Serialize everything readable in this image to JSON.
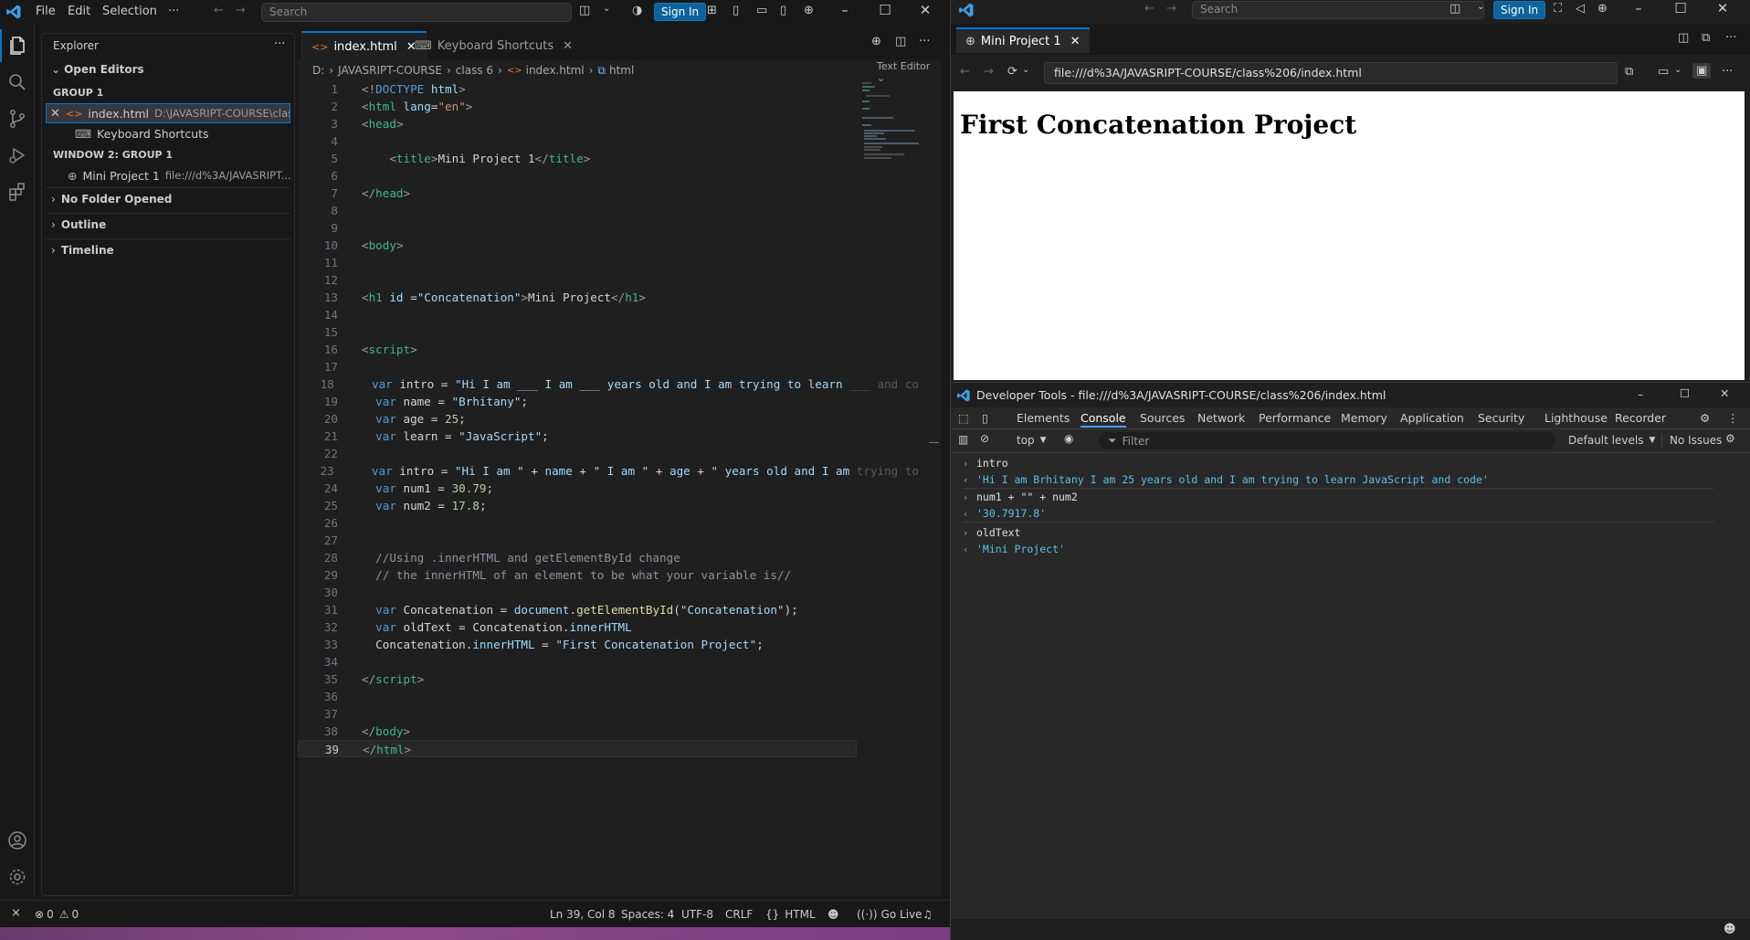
{
  "left_window": {
    "menu": [
      "File",
      "Edit",
      "Selection",
      "···"
    ],
    "search_placeholder": "Search",
    "sign_in": "Sign In",
    "explorer": {
      "title": "Explorer",
      "open_editors": "Open Editors",
      "group1": "GROUP 1",
      "file1_name": "index.html",
      "file1_path": "D:\\JAVASRIPT-COURSE\\clas...",
      "file2_name": "Keyboard Shortcuts",
      "window2_group": "WINDOW 2: GROUP 1",
      "file3_name": "Mini Project 1",
      "file3_path": "file:///d%3A/JAVASRIPT...",
      "no_folder": "No Folder Opened",
      "outline": "Outline",
      "timeline": "Timeline"
    },
    "tabs": {
      "active": "index.html",
      "inactive": "Keyboard Shortcuts"
    },
    "breadcrumb": {
      "drive": "D:",
      "folder": "JAVASRIPT-COURSE",
      "subfolder": "class 6",
      "file": "index.html",
      "symbol": "html"
    },
    "text_editor_label": "Text Editor",
    "line_numbers": [
      "1",
      "2",
      "3",
      "4",
      "5",
      "6",
      "7",
      "8",
      "9",
      "10",
      "11",
      "12",
      "13",
      "14",
      "15",
      "16",
      "17",
      "18",
      "19",
      "20",
      "21",
      "22",
      "23",
      "24",
      "25",
      "26",
      "27",
      "28",
      "29",
      "30",
      "31",
      "32",
      "33",
      "34",
      "35",
      "36",
      "37",
      "38",
      "39"
    ],
    "code": {
      "l1a": "<!",
      "l1b": "DOCTYPE",
      "l1c": " html",
      "l1d": ">",
      "l2a": "<",
      "l2b": "html",
      "l2c": " lang",
      "l2d": "=",
      "l2e": "\"en\"",
      "l2f": ">",
      "l3a": "<",
      "l3b": "head",
      "l3c": ">",
      "l5a": "<",
      "l5b": "title",
      "l5c": ">",
      "l5d": "Mini Project 1",
      "l5e": "</",
      "l5f": "title",
      "l5g": ">",
      "l7a": "</",
      "l7b": "head",
      "l7c": ">",
      "l10a": "<",
      "l10b": "body",
      "l10c": ">",
      "l13a": "<",
      "l13b": "h1",
      "l13c": " id ",
      "l13d": "=",
      "l13e": "\"Concatenation\"",
      "l13f": ">",
      "l13g": "Mini Project",
      "l13h": "</",
      "l13i": "h1",
      "l13j": ">",
      "l16a": "<",
      "l16b": "script",
      "l16c": ">",
      "l18a": "var",
      "l18b": " intro = ",
      "l18c": "\"Hi I am ___ I am ___ years old and I am trying to learn",
      "l18d": " ___ and co",
      "l19a": "var",
      "l19b": " name = ",
      "l19c": "\"Brhitany\"",
      "l19d": ";",
      "l20a": "var",
      "l20b": " age = ",
      "l20c": "25",
      "l20d": ";",
      "l21a": "var",
      "l21b": " learn = ",
      "l21c": "\"JavaScript\"",
      "l21d": ";",
      "l23a": "var",
      "l23b": " intro = ",
      "l23c": "\"Hi I am \"",
      "l23d": " + ",
      "l23e": "name",
      "l23f": " + ",
      "l23g": "\" I am \"",
      "l23h": " + ",
      "l23i": "age",
      "l23j": " + ",
      "l23k": "\" years old and I am",
      "l23l": " trying to",
      "l24a": "var",
      "l24b": " num1 = ",
      "l24c": "30.79",
      "l24d": ";",
      "l25a": "var",
      "l25b": " num2 = ",
      "l25c": "17.8",
      "l25d": ";",
      "l28": "//Using .innerHTML and getElementById change",
      "l29": "// the innerHTML of an element to be what your variable is//",
      "l31a": "var",
      "l31b": " Concatenation = ",
      "l31c": "document",
      "l31d": ".",
      "l31e": "getElementById",
      "l31f": "(",
      "l31g": "\"Concatenation\"",
      "l31h": ");",
      "l32a": "var",
      "l32b": " oldText = Concatenation.",
      "l32c": "innerHTML",
      "l33a": "Concatenation.",
      "l33b": "innerHTML",
      "l33c": " = ",
      "l33d": "\"First Concatenation Project\"",
      "l33e": ";",
      "l35a": "</",
      "l35b": "script",
      "l35c": ">",
      "l38a": "</",
      "l38b": "body",
      "l38c": ">",
      "l39a": "</",
      "l39b": "html",
      "l39c": ">"
    },
    "status": {
      "errors": "0",
      "warnings": "0",
      "position": "Ln 39, Col 8",
      "spaces": "Spaces: 4",
      "encoding": "UTF-8",
      "eol": "CRLF",
      "language": "HTML",
      "go_live": "Go Live"
    }
  },
  "right_window": {
    "search_placeholder": "Search",
    "sign_in": "Sign In",
    "tab_title": "Mini Project 1",
    "url": "file:///d%3A/JAVASRIPT-COURSE/class%206/index.html",
    "page_heading": "First Concatenation Project",
    "devtools": {
      "title": "Developer Tools - file:///d%3A/JAVASRIPT-COURSE/class%206/index.html",
      "tabs": [
        "Elements",
        "Console",
        "Sources",
        "Network",
        "Performance",
        "Memory",
        "Application",
        "Security",
        "Lighthouse",
        "Recorder"
      ],
      "context": "top",
      "filter_placeholder": "Filter",
      "levels": "Default levels",
      "issues": "No Issues",
      "console": [
        {
          "type": "input",
          "text": "intro"
        },
        {
          "type": "output",
          "text": "'Hi I am Brhitany I am 25 years old and I am trying to learn JavaScript and code'"
        },
        {
          "type": "input",
          "text": "num1  + \"\" + num2"
        },
        {
          "type": "output",
          "text": "'30.7917.8'"
        },
        {
          "type": "input",
          "text": "oldText"
        },
        {
          "type": "output",
          "text": "'Mini Project'"
        }
      ]
    }
  },
  "colors": {
    "accent": "#0078d4",
    "sign_in": "#0e639c",
    "console_output": "#5cc0e8"
  }
}
